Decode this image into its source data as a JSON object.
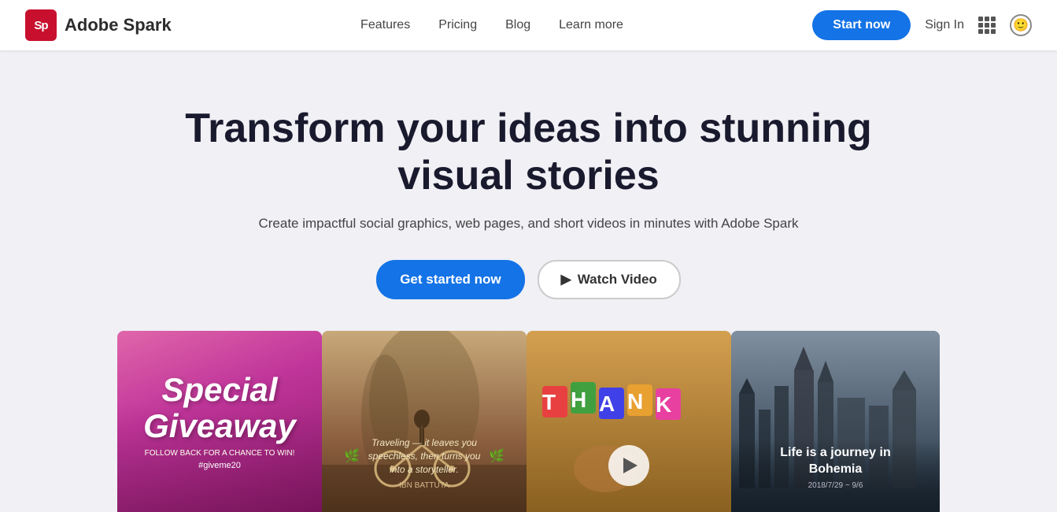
{
  "brand": {
    "logo_letters": "Sp",
    "name": "Adobe Spark"
  },
  "navbar": {
    "links": [
      {
        "id": "features",
        "label": "Features"
      },
      {
        "id": "pricing",
        "label": "Pricing"
      },
      {
        "id": "blog",
        "label": "Blog"
      },
      {
        "id": "learn-more",
        "label": "Learn more"
      }
    ],
    "cta_label": "Start now",
    "sign_in_label": "Sign In"
  },
  "hero": {
    "headline": "Transform your ideas into stunning visual stories",
    "subheadline": "Create impactful social graphics, web pages, and short videos in minutes with Adobe Spark",
    "cta_primary": "Get started now",
    "cta_secondary": "Watch Video",
    "play_symbol": "▶"
  },
  "preview_cards": [
    {
      "id": "giveaway",
      "title_line1": "Special",
      "title_line2": "Giveaway",
      "sub": "FOLLOW BACK FOR A CHANCE TO WIN!",
      "hashtag": "#giveme20"
    },
    {
      "id": "bicycle",
      "quote": "Traveling — it leaves you speechless, then turns you into a storyteller.",
      "author": "IBN BATTUTA"
    },
    {
      "id": "thankyou",
      "text": "THANK"
    },
    {
      "id": "bohemia",
      "title": "Life is a journey in Bohemia",
      "date": "2018/7/29 ~ 9/6"
    }
  ],
  "colors": {
    "accent_blue": "#1473e6",
    "logo_red": "#c8102e",
    "text_dark": "#1a1a2e",
    "text_muted": "#444"
  }
}
